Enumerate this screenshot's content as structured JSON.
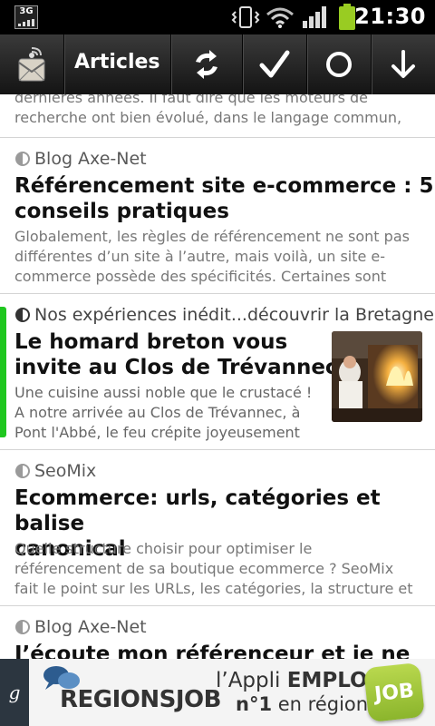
{
  "status_bar": {
    "network": "3G",
    "time": "21:30",
    "icons": [
      "vibrate-icon",
      "wifi-icon",
      "signal-icon",
      "battery-icon"
    ]
  },
  "action_bar": {
    "title": "Articles",
    "buttons": [
      "refresh-icon",
      "mark-read-check-icon",
      "mark-unread-circle-icon",
      "download-arrow-icon"
    ]
  },
  "articles": [
    {
      "excerpt_lines": [
        "dernières années. Il faut dire que les moteurs de",
        "recherche ont bien évolué, dans le langage commun,"
      ]
    },
    {
      "source": "Blog Axe-Net",
      "title_lines": [
        "Référencement site e-commerce : 5",
        "conseils pratiques"
      ],
      "excerpt_lines": [
        "Globalement, les règles de référencement ne sont pas",
        "différentes d’un site à l’autre, mais voilà, un site e-",
        "commerce possède des spécificités. Certaines sont"
      ]
    },
    {
      "source": "Nos expériences inédit...découvrir la Bretagne !",
      "title_lines": [
        "Le homard breton vous",
        "invite au Clos de Trévannec"
      ],
      "excerpt_lines": [
        "Une cuisine aussi noble que le crustacé !",
        "A notre arrivée au Clos de Trévannec, à",
        "Pont l'Abbé, le feu crépite joyeusement"
      ],
      "unread": true
    },
    {
      "source": "SeoMix",
      "title_lines": [
        "Ecommerce: urls, catégories et balise",
        "canonical"
      ],
      "excerpt_lines": [
        "Quelle structure choisir pour optimiser le",
        "référencement de sa boutique ecommerce ? SeoMix",
        "fait le point sur les URLs, les catégories, la structure et"
      ]
    },
    {
      "source": "Blog Axe-Net",
      "title_lines": [
        "J’écoute mon référenceur et je ne fais"
      ]
    }
  ],
  "ad": {
    "logo": "REGIONSJOB",
    "line1_prefix": "l’Appli ",
    "line1_bold": "EMPLOI",
    "line2_bold": "n°1",
    "line2_rest": " en région",
    "badge": "JOB",
    "side_glyph": "g"
  },
  "colors": {
    "accent_unread": "#1fc71f",
    "actionbar": "#1e1e1e",
    "badge_green": "#9cc43a"
  }
}
